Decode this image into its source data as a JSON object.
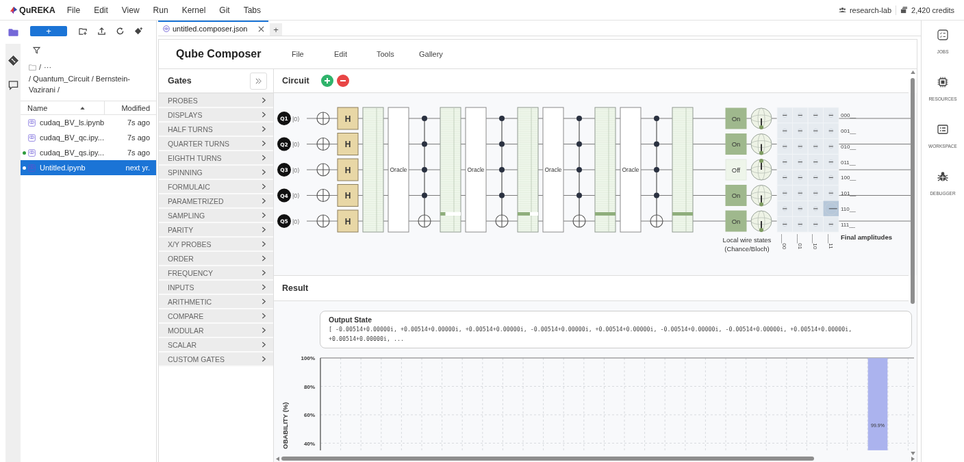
{
  "menubar": {
    "logo": "QuREKA",
    "menus": [
      "File",
      "Edit",
      "View",
      "Run",
      "Kernel",
      "Git",
      "Tabs"
    ],
    "workspace": "research-lab",
    "credits": "2,420 credits"
  },
  "activity_bar": [
    {
      "kind": "folder",
      "selected": true
    },
    {
      "kind": "git",
      "selected": false
    },
    {
      "kind": "chat",
      "selected": false
    }
  ],
  "file_browser": {
    "new_button": "+",
    "breadcrumb_root": "/",
    "breadcrumb_more": "···",
    "path": "/ Quantum_Circuit / Bernstein-Vazirani /",
    "columns": [
      {
        "label": "Name",
        "sorted": true
      },
      {
        "label": "Modified",
        "sorted": false
      }
    ],
    "files": [
      {
        "name": "cudaq_BV_ls.ipynb",
        "modified": "7s ago",
        "running": false,
        "selected": false
      },
      {
        "name": "cudaq_BV_qc.ipy...",
        "modified": "7s ago",
        "running": false,
        "selected": false
      },
      {
        "name": "cudaq_BV_qs.ipy...",
        "modified": "7s ago",
        "running": true,
        "selected": false
      },
      {
        "name": "Untitled.ipynb",
        "modified": "next yr.",
        "running": true,
        "selected": true
      }
    ]
  },
  "tabs": [
    {
      "title": "untitled.composer.json",
      "selected": true
    }
  ],
  "new_tab": "+",
  "composer": {
    "title": "Qube Composer",
    "menus": [
      "File",
      "Edit",
      "Tools",
      "Gallery"
    ],
    "gates": {
      "title": "Gates",
      "categories": [
        "PROBES",
        "DISPLAYS",
        "HALF TURNS",
        "QUARTER TURNS",
        "EIGHTH TURNS",
        "SPINNING",
        "FORMULAIC",
        "PARAMETRIZED",
        "SAMPLING",
        "PARITY",
        "X/Y PROBES",
        "ORDER",
        "FREQUENCY",
        "INPUTS",
        "ARITHMETIC",
        "COMPARE",
        "MODULAR",
        "SCALAR",
        "CUSTOM GATES"
      ]
    },
    "circuit": {
      "title": "Circuit",
      "qubits": [
        {
          "label": "Q1",
          "state": "|0⟩"
        },
        {
          "label": "Q2",
          "state": "|0⟩"
        },
        {
          "label": "Q3",
          "state": "|0⟩"
        },
        {
          "label": "Q4",
          "state": "|0⟩"
        },
        {
          "label": "Q5",
          "state": "|0⟩"
        }
      ],
      "columns": [
        {
          "kind": "x"
        },
        {
          "kind": "h",
          "gates": [
            "H",
            "H",
            "H",
            "H",
            "H"
          ]
        },
        {
          "kind": "display"
        },
        {
          "kind": "oracle",
          "label": "Oracle"
        },
        {
          "kind": "cnot",
          "wires": [
            {
              "kind": "control"
            },
            {
              "kind": "control"
            },
            {
              "kind": "control"
            },
            {
              "kind": "control"
            },
            {
              "kind": "target"
            }
          ]
        },
        {
          "kind": "display",
          "level": 0.25
        },
        {
          "kind": "oracle",
          "label": "Oracle"
        },
        {
          "kind": "cnot",
          "wires": [
            {
              "kind": "control"
            },
            {
              "kind": "control"
            },
            {
              "kind": "control"
            },
            {
              "kind": "control"
            },
            {
              "kind": "target"
            }
          ]
        },
        {
          "kind": "display",
          "level": 0.6
        },
        {
          "kind": "oracle",
          "label": "Oracle"
        },
        {
          "kind": "cnot",
          "wires": [
            {
              "kind": "control"
            },
            {
              "kind": "control"
            },
            {
              "kind": "control"
            },
            {
              "kind": "control"
            },
            {
              "kind": "target"
            }
          ]
        },
        {
          "kind": "display",
          "level": 1
        },
        {
          "kind": "oracle",
          "label": "Oracle"
        },
        {
          "kind": "cnot",
          "wires": [
            {
              "kind": "control"
            },
            {
              "kind": "control"
            },
            {
              "kind": "control"
            },
            {
              "kind": "control"
            },
            {
              "kind": "target"
            }
          ]
        },
        {
          "kind": "display",
          "level": 1
        }
      ],
      "wire_states": [
        {
          "label": "On",
          "on": true
        },
        {
          "label": "On",
          "on": true
        },
        {
          "label": "Off",
          "on": false
        },
        {
          "label": "On",
          "on": true
        },
        {
          "label": "On",
          "on": true
        }
      ],
      "wire_states_caption": [
        "Local wire states",
        "(Chance/Bloch)"
      ],
      "amplitudes": {
        "caption": "Final amplitudes",
        "columns": [
          "___00",
          "___01",
          "___10",
          "___11"
        ],
        "rows": [
          {
            "label": "000__",
            "cells": [
              {
                "highlighted": false
              },
              {
                "highlighted": false
              },
              {
                "highlighted": false
              },
              {
                "highlighted": false
              }
            ]
          },
          {
            "label": "001__",
            "cells": [
              {
                "highlighted": false
              },
              {
                "highlighted": false
              },
              {
                "highlighted": false
              },
              {
                "highlighted": false
              }
            ]
          },
          {
            "label": "010__",
            "cells": [
              {
                "highlighted": false
              },
              {
                "highlighted": false
              },
              {
                "highlighted": false
              },
              {
                "highlighted": false
              }
            ]
          },
          {
            "label": "011__",
            "cells": [
              {
                "highlighted": false
              },
              {
                "highlighted": false
              },
              {
                "highlighted": false
              },
              {
                "highlighted": false
              }
            ]
          },
          {
            "label": "100__",
            "cells": [
              {
                "highlighted": false
              },
              {
                "highlighted": false
              },
              {
                "highlighted": false
              },
              {
                "highlighted": false
              }
            ]
          },
          {
            "label": "101__",
            "cells": [
              {
                "highlighted": false
              },
              {
                "highlighted": false
              },
              {
                "highlighted": false
              },
              {
                "highlighted": false
              }
            ]
          },
          {
            "label": "110__",
            "cells": [
              {
                "highlighted": false
              },
              {
                "highlighted": false
              },
              {
                "highlighted": false
              },
              {
                "highlighted": true
              }
            ]
          },
          {
            "label": "111__",
            "cells": [
              {
                "highlighted": false
              },
              {
                "highlighted": false
              },
              {
                "highlighted": false
              },
              {
                "highlighted": false
              }
            ]
          }
        ]
      }
    },
    "result": {
      "title": "Result",
      "output_state": {
        "title": "Output State",
        "value": "[ -0.00514+0.00000i, +0.00514+0.00000i, +0.00514+0.00000i, -0.00514+0.00000i, +0.00514+0.00000i, -0.00514+0.00000i, -0.00514+0.00000i, +0.00514+0.00000i, +0.00514+0.00000i, ..."
      },
      "chart_data": {
        "type": "bar",
        "ylabel": "OBABILITY (%)",
        "ylim": [
          35,
          100
        ],
        "yticks": [
          {
            "value": 40,
            "label": "40%"
          },
          {
            "value": 60,
            "label": "60%"
          },
          {
            "value": 80,
            "label": "80%"
          },
          {
            "value": 100,
            "label": "100%"
          }
        ],
        "grid": true,
        "values": [
          null,
          null,
          null,
          null,
          null,
          null,
          null,
          null,
          null,
          null,
          null,
          null,
          null,
          null,
          null,
          null,
          null,
          null,
          null,
          null,
          null,
          null,
          null,
          null,
          null,
          null,
          null,
          99.9,
          null
        ],
        "value_labels": [
          null,
          null,
          null,
          null,
          null,
          null,
          null,
          null,
          null,
          null,
          null,
          null,
          null,
          null,
          null,
          null,
          null,
          null,
          null,
          null,
          null,
          null,
          null,
          null,
          null,
          null,
          null,
          "99.9%",
          null
        ]
      }
    }
  },
  "right_sidebar": [
    {
      "kind": "jobs",
      "label": "JOBS"
    },
    {
      "kind": "resources",
      "label": "RESOURCES"
    },
    {
      "kind": "workspace",
      "label": "WORKSPACE"
    },
    {
      "kind": "debugger",
      "label": "DEBUGGER"
    }
  ]
}
